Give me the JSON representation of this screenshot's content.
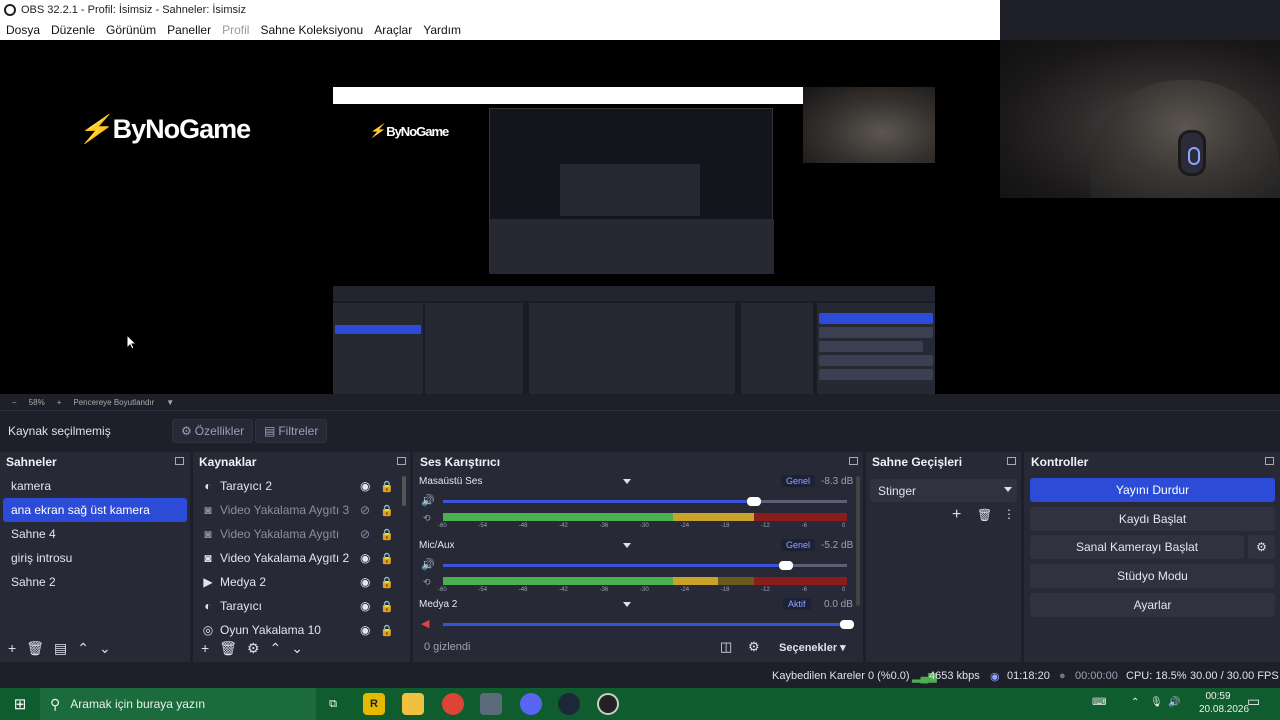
{
  "window": {
    "title": "OBS 32.2.1 - Profil: İsimsiz - Sahneler: İsimsiz"
  },
  "menu": [
    {
      "label": "Dosya",
      "enabled": true
    },
    {
      "label": "Düzenle",
      "enabled": true
    },
    {
      "label": "Görünüm",
      "enabled": true
    },
    {
      "label": "Paneller",
      "enabled": true
    },
    {
      "label": "Profil",
      "enabled": false
    },
    {
      "label": "Sahne Koleksiyonu",
      "enabled": true
    },
    {
      "label": "Araçlar",
      "enabled": true
    },
    {
      "label": "Yardım",
      "enabled": true
    }
  ],
  "preview": {
    "brand_logo_text": "ByNoGame",
    "zoom": "58%",
    "fit_label": "Pencereye Boyutlandır"
  },
  "source_toolbar": {
    "label": "Kaynak seçilmemiş",
    "properties_label": "Özellikler",
    "filters_label": "Filtreler"
  },
  "scenes": {
    "title": "Sahneler",
    "items": [
      {
        "label": "kamera",
        "selected": false
      },
      {
        "label": "ana ekran sağ üst  kamera",
        "selected": true
      },
      {
        "label": "Sahne 4",
        "selected": false
      },
      {
        "label": "giriş introsu",
        "selected": false
      },
      {
        "label": "Sahne 2",
        "selected": false
      }
    ]
  },
  "sources": {
    "title": "Kaynaklar",
    "items": [
      {
        "label": "Tarayıcı 2",
        "icon": "globe-icon",
        "visible": true,
        "locked": true
      },
      {
        "label": "Video Yakalama Aygıtı 3",
        "icon": "camera-icon",
        "visible": false,
        "locked": true
      },
      {
        "label": "Video Yakalama Aygıtı",
        "icon": "camera-icon",
        "visible": false,
        "locked": true
      },
      {
        "label": "Video Yakalama Aygıtı 2",
        "icon": "camera-icon",
        "visible": true,
        "locked": true
      },
      {
        "label": "Medya 2",
        "icon": "play-icon",
        "visible": true,
        "locked": true
      },
      {
        "label": "Tarayıcı",
        "icon": "globe-icon",
        "visible": true,
        "locked": true
      },
      {
        "label": "Oyun Yakalama 10",
        "icon": "gamepad-icon",
        "visible": true,
        "locked": true
      }
    ]
  },
  "mixer": {
    "title": "Ses Karıştırıcı",
    "channels": [
      {
        "name": "Masaüstü Ses",
        "badge": "Genel",
        "db": "-8.3 dB",
        "volume": 0.77,
        "level": 0.82,
        "muted": false
      },
      {
        "name": "Mic/Aux",
        "badge": "Genel",
        "db": "-5.2 dB",
        "volume": 0.85,
        "level": 0.68,
        "muted": false
      },
      {
        "name": "Medya 2",
        "badge": "Aktif",
        "db": "0.0 dB",
        "volume": 1.0,
        "level": 0.0,
        "muted": true
      }
    ],
    "ticks": [
      "-60",
      "-54",
      "-48",
      "-42",
      "-36",
      "-30",
      "-24",
      "-18",
      "-12",
      "-6",
      "0"
    ],
    "hidden_label": "0 gizlendi",
    "options_label": "Seçenekler"
  },
  "transitions": {
    "title": "Sahne Geçişleri",
    "selected": "Stinger"
  },
  "controls": {
    "title": "Kontroller",
    "stop_stream": "Yayını Durdur",
    "start_recording": "Kaydı Başlat",
    "virtual_camera": "Sanal Kamerayı Başlat",
    "studio_mode": "Stüdyo Modu",
    "settings": "Ayarlar"
  },
  "status": {
    "dropped_frames": "Kaybedilen Kareler 0 (%0.0)",
    "bitrate": "4653 kbps",
    "stream_time": "01:18:20",
    "rec_time": "00:00:00",
    "cpu": "CPU: 18.5%",
    "fps": "30.00 / 30.00 FPS"
  },
  "taskbar": {
    "search_placeholder": "Aramak için buraya yazın",
    "time": "00:59",
    "date": "20.08.2026"
  },
  "colors": {
    "accent": "#2c4bd6",
    "dock_bg": "#272936",
    "app_bg": "#1e1f29",
    "meter_green": "#4caf50",
    "meter_yellow": "#c9a227",
    "meter_red": "#c62828"
  }
}
